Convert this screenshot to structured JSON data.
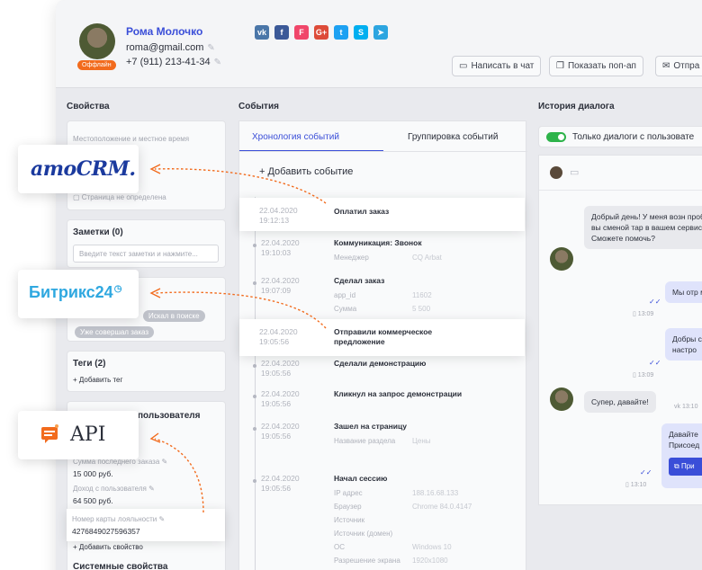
{
  "user": {
    "name": "Рома Молочко",
    "email": "roma@gmail.com",
    "phone": "+7 (911) 213-41-34",
    "status": "Оффлайн"
  },
  "socials": [
    {
      "icon": "vk-icon",
      "glyph": "vk",
      "color": "#4a76a8"
    },
    {
      "icon": "facebook-icon",
      "glyph": "f",
      "color": "#3b5998"
    },
    {
      "icon": "flamp-icon",
      "glyph": "F",
      "color": "#f0466a"
    },
    {
      "icon": "google-plus-icon",
      "glyph": "G+",
      "color": "#dd4b39"
    },
    {
      "icon": "twitter-icon",
      "glyph": "t",
      "color": "#1da1f2"
    },
    {
      "icon": "skype-icon",
      "glyph": "S",
      "color": "#00aff0"
    },
    {
      "icon": "telegram-icon",
      "glyph": "➤",
      "color": "#2ca5e0"
    }
  ],
  "actions": {
    "write_chat": "Написать в чат",
    "show_popup": "Показать поп-ап",
    "send": "Отпра"
  },
  "columns": {
    "properties": "Свойства",
    "events": "События",
    "history": "История диалога"
  },
  "left": {
    "location_label": "Местоположение и местное время",
    "page_undefined": "Страница не определена",
    "notes_title": "Заметки (0)",
    "notes_placeholder": "Введите текст заметки и нажмите...",
    "segment_tags": [
      "Искал в поиске",
      "Уже совершал заказ"
    ],
    "tags_title": "Теги (2)",
    "add_tag": "Добавить тег",
    "user_props_title": "пользователя",
    "last_order_label": "Сумма последнего заказа",
    "last_order_value": "15 000 руб.",
    "income_label": "Доход с пользователя",
    "income_value": "64 500 руб.",
    "loyalty_label": "Номер карты лояльности",
    "loyalty_value": "4276849027596357",
    "add_property": "Добавить свойство",
    "system_props": "Системные свойства"
  },
  "center": {
    "tab_chronology": "Хронология событий",
    "tab_grouping": "Группировка событий",
    "add_event": "Добавить событие",
    "events": [
      {
        "date": "22.04.2020",
        "time": "19:12:13",
        "title": "Оплатил заказ",
        "props": []
      },
      {
        "date": "22.04.2020",
        "time": "19:10:03",
        "title": "Коммуникация: Звонок",
        "props": [
          {
            "k": "Менеджер",
            "v": "CQ Arbat"
          }
        ]
      },
      {
        "date": "22.04.2020",
        "time": "19:07:09",
        "title": "Сделал заказ",
        "props": [
          {
            "k": "app_id",
            "v": "11602"
          },
          {
            "k": "Сумма",
            "v": "5 500"
          }
        ]
      },
      {
        "date": "22.04.2020",
        "time": "19:05:56",
        "title": "Отправили коммерческое предложение",
        "props": []
      },
      {
        "date": "22.04.2020",
        "time": "19:05:56",
        "title": "Сделали демонстрацию",
        "props": []
      },
      {
        "date": "22.04.2020",
        "time": "19:05:56",
        "title": "Кликнул на запрос демонстрации",
        "props": []
      },
      {
        "date": "22.04.2020",
        "time": "19:05:56",
        "title": "Зашел на страницу",
        "props": [
          {
            "k": "Название раздела",
            "v": "Цены"
          }
        ]
      },
      {
        "date": "22.04.2020",
        "time": "19:05:56",
        "title": "Начал сессию",
        "props": [
          {
            "k": "IP адрес",
            "v": "188.16.68.133"
          },
          {
            "k": "Браузер",
            "v": "Chrome 84.0.4147"
          },
          {
            "k": "Источник",
            "v": ""
          },
          {
            "k": "Источник (домен)",
            "v": ""
          },
          {
            "k": "ОС",
            "v": "Windows 10"
          },
          {
            "k": "Разрешение экрана",
            "v": "1920x1080"
          }
        ]
      }
    ]
  },
  "right": {
    "filter_label": "Только диалоги с пользовате",
    "msg1": "Добрый день! У меня возн проблемы с вы сменой тар в вашем сервисе. Сможете помочь?",
    "msg2": "Мы отр минут",
    "msg2_time": "13:09",
    "msg3": "Добры созвон настро",
    "msg3_time": "13:09",
    "msg4": "Супер, давайте!",
    "msg4_time": "13:10",
    "msg5": "Давайте Присоед",
    "msg5_btn": "При",
    "msg5_time": "13:10"
  },
  "integrations": {
    "amo_logo": "amoCRM.",
    "bitrix_logo": "Битрикс24",
    "api_label": "API"
  },
  "colors": {
    "accent": "#3a4ed8",
    "connector": "#f26b1d",
    "bitrix": "#2fa8e0",
    "amo": "#1b3a9e"
  }
}
